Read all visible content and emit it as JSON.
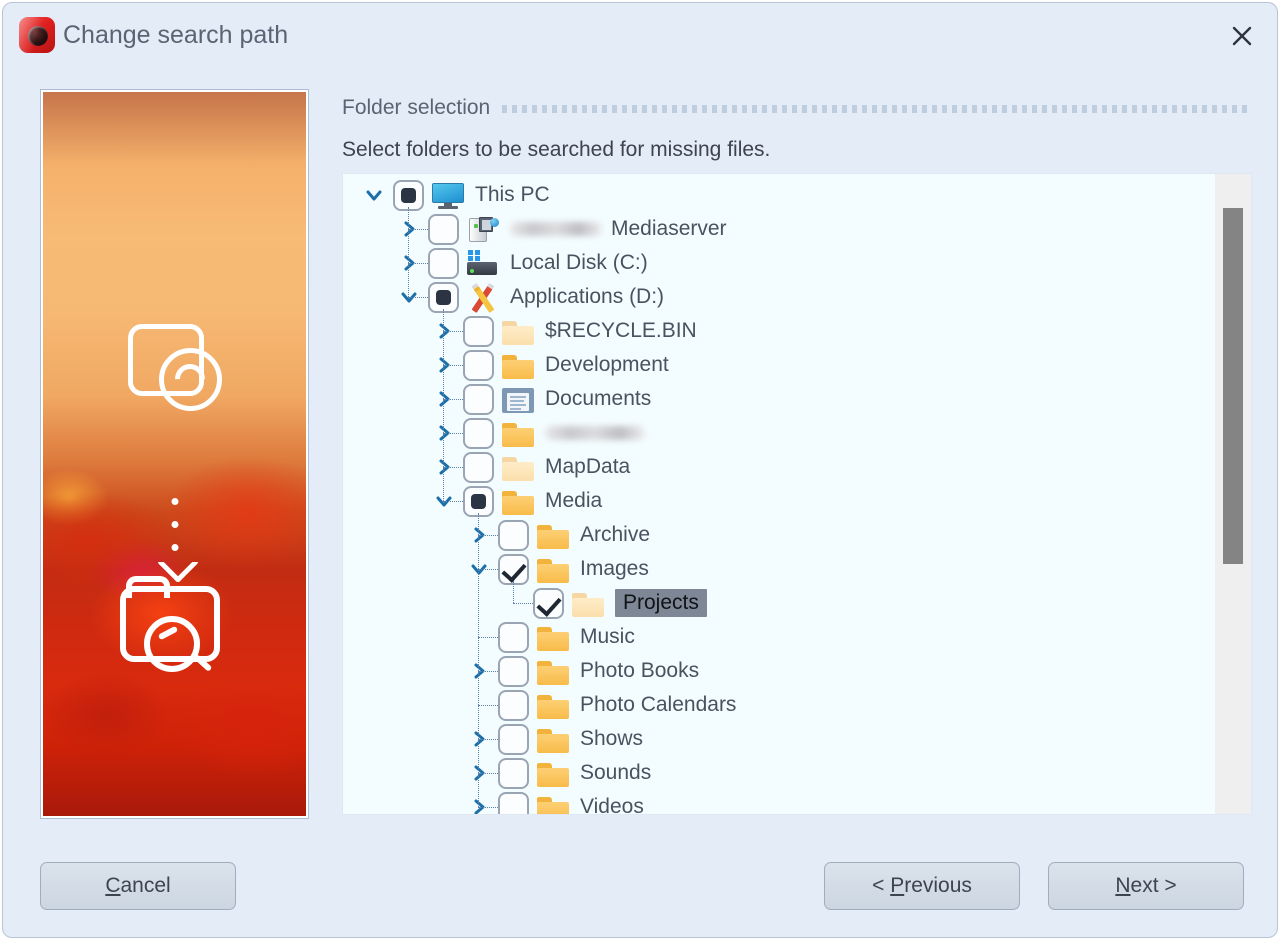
{
  "window": {
    "title": "Change search path",
    "app_icon": "camera-lens-icon",
    "close_icon": "close-icon"
  },
  "preview": {
    "name": "poppy-field-photo",
    "overlay_icons": [
      "photo-lens-icon",
      "chevron-down-icon",
      "folder-search-icon"
    ]
  },
  "section": {
    "title": "Folder selection",
    "subtitle": "Select folders to be searched for missing files."
  },
  "tree": {
    "items": [
      {
        "label": "This PC",
        "depth": 0,
        "check": "partial",
        "icon": "monitor-icon",
        "twisty": "expanded",
        "selected": false,
        "redacted": false
      },
      {
        "label": "Mediaserver",
        "depth": 1,
        "check": "unchecked",
        "icon": "server-icon",
        "twisty": "collapsed",
        "selected": false,
        "redacted": true
      },
      {
        "label": "Local Disk (C:)",
        "depth": 1,
        "check": "unchecked",
        "icon": "hdd-icon",
        "twisty": "collapsed",
        "selected": false,
        "redacted": false
      },
      {
        "label": "Applications (D:)",
        "depth": 1,
        "check": "partial",
        "icon": "pencils-icon",
        "twisty": "expanded",
        "selected": false,
        "redacted": false
      },
      {
        "label": "$RECYCLE.BIN",
        "depth": 2,
        "check": "unchecked",
        "icon": "folder-pale-icon",
        "twisty": "collapsed",
        "selected": false,
        "redacted": false
      },
      {
        "label": "Development",
        "depth": 2,
        "check": "unchecked",
        "icon": "folder-icon",
        "twisty": "collapsed",
        "selected": false,
        "redacted": false
      },
      {
        "label": "Documents",
        "depth": 2,
        "check": "unchecked",
        "icon": "documents-folder-icon",
        "twisty": "collapsed",
        "selected": false,
        "redacted": false
      },
      {
        "label": "",
        "depth": 2,
        "check": "unchecked",
        "icon": "folder-icon",
        "twisty": "collapsed",
        "selected": false,
        "redacted": true
      },
      {
        "label": "MapData",
        "depth": 2,
        "check": "unchecked",
        "icon": "folder-pale-icon",
        "twisty": "collapsed",
        "selected": false,
        "redacted": false
      },
      {
        "label": "Media",
        "depth": 2,
        "check": "partial",
        "icon": "folder-icon",
        "twisty": "expanded",
        "selected": false,
        "redacted": false
      },
      {
        "label": "Archive",
        "depth": 3,
        "check": "unchecked",
        "icon": "folder-icon",
        "twisty": "collapsed",
        "selected": false,
        "redacted": false
      },
      {
        "label": "Images",
        "depth": 3,
        "check": "checked",
        "icon": "folder-icon",
        "twisty": "expanded",
        "selected": false,
        "redacted": false
      },
      {
        "label": "Projects",
        "depth": 4,
        "check": "checked",
        "icon": "folder-pale-icon",
        "twisty": "none",
        "selected": true,
        "redacted": false
      },
      {
        "label": "Music",
        "depth": 3,
        "check": "unchecked",
        "icon": "folder-icon",
        "twisty": "none",
        "selected": false,
        "redacted": false
      },
      {
        "label": "Photo Books",
        "depth": 3,
        "check": "unchecked",
        "icon": "folder-icon",
        "twisty": "collapsed",
        "selected": false,
        "redacted": false
      },
      {
        "label": "Photo Calendars",
        "depth": 3,
        "check": "unchecked",
        "icon": "folder-icon",
        "twisty": "none",
        "selected": false,
        "redacted": false
      },
      {
        "label": "Shows",
        "depth": 3,
        "check": "unchecked",
        "icon": "folder-icon",
        "twisty": "collapsed",
        "selected": false,
        "redacted": false
      },
      {
        "label": "Sounds",
        "depth": 3,
        "check": "unchecked",
        "icon": "folder-icon",
        "twisty": "collapsed",
        "selected": false,
        "redacted": false
      },
      {
        "label": "Videos",
        "depth": 3,
        "check": "unchecked",
        "icon": "folder-icon",
        "twisty": "collapsed",
        "selected": false,
        "redacted": false
      }
    ]
  },
  "footer": {
    "cancel": {
      "prefix": "",
      "accel": "C",
      "rest": "ancel",
      "suffix": ""
    },
    "previous": {
      "prefix": "< ",
      "accel": "P",
      "rest": "revious",
      "suffix": ""
    },
    "next": {
      "prefix": "",
      "accel": "N",
      "rest": "ext",
      "suffix": " >"
    }
  },
  "colors": {
    "dialog_bg": "#e4ecf8",
    "tree_bg": "#f3fcfe",
    "accent_blue": "#1b6fa8",
    "selection_bg": "#7e8795",
    "folder_yellow": "#f8bb49",
    "scrollbar_thumb": "#848484"
  }
}
